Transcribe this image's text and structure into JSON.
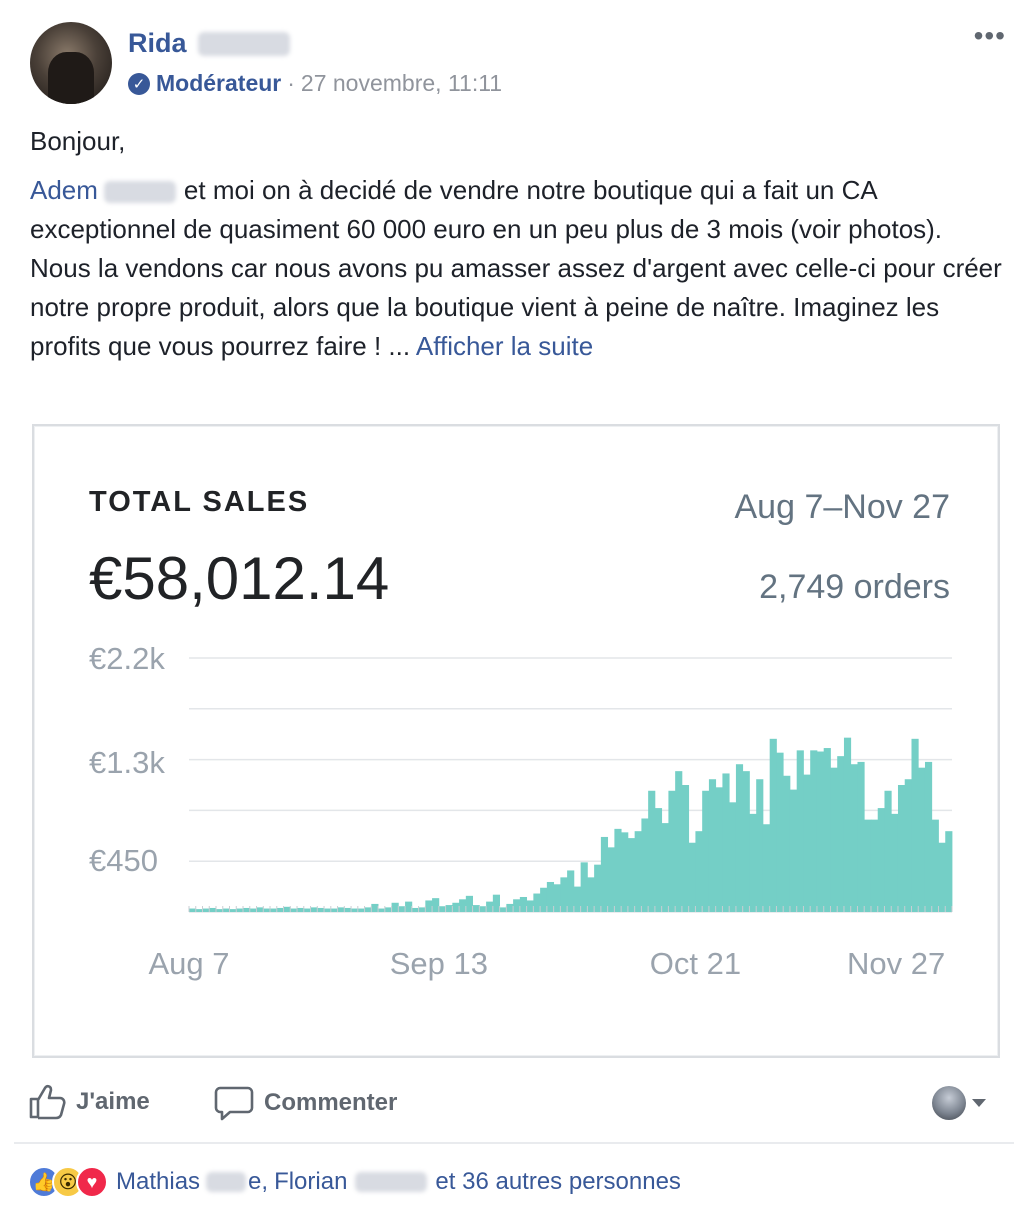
{
  "post": {
    "author_name": "Rida",
    "role": "Modérateur",
    "separator": "·",
    "timestamp": "27 novembre, 11:11",
    "more_icon": "more-horizontal-icon",
    "greeting": "Bonjour,",
    "mention": "Adem",
    "paragraph1_rest": "et moi on à decidé de vendre notre boutique qui a fait un CA exceptionnel de quasiment 60 000 euro en un peu plus de 3 mois (voir photos).",
    "paragraph2": "Nous la vendons car nous avons pu amasser assez d'argent avec celle-ci pour créer notre propre produit, alors que la boutique vient à peine de naître. Imaginez les profits que vous pourrez faire ! ...",
    "see_more": "Afficher la suite"
  },
  "chart_data": {
    "type": "bar",
    "title": "TOTAL SALES",
    "total": "€58,012.14",
    "date_range": "Aug 7–Nov 27",
    "orders": "2,749 orders",
    "y_ticks": [
      "€2.2k",
      "€1.3k",
      "€450"
    ],
    "y_tick_values": [
      2200,
      1300,
      450
    ],
    "x_ticks": [
      "Aug 7",
      "Sep 13",
      "Oct 21",
      "Nov 27"
    ],
    "x_tick_indices": [
      0,
      37,
      75,
      112
    ],
    "ylim": [
      0,
      2200
    ],
    "bar_color": "#74cfc6",
    "values": [
      30,
      25,
      30,
      35,
      25,
      30,
      25,
      30,
      35,
      30,
      40,
      30,
      30,
      35,
      45,
      30,
      35,
      30,
      40,
      35,
      30,
      30,
      40,
      35,
      30,
      30,
      40,
      70,
      30,
      40,
      80,
      50,
      90,
      35,
      40,
      100,
      120,
      50,
      60,
      80,
      110,
      140,
      60,
      50,
      90,
      150,
      40,
      70,
      110,
      130,
      100,
      160,
      210,
      260,
      240,
      300,
      360,
      220,
      430,
      300,
      410,
      650,
      560,
      720,
      690,
      640,
      700,
      810,
      1050,
      900,
      770,
      1050,
      1220,
      1100,
      600,
      700,
      1050,
      1150,
      1080,
      1200,
      950,
      1280,
      1220,
      850,
      1150,
      760,
      1500,
      1380,
      1180,
      1060,
      1400,
      1190,
      1400,
      1390,
      1420,
      1250,
      1350,
      1510,
      1280,
      1300,
      800,
      800,
      900,
      1050,
      850,
      1100,
      1150,
      1500,
      1250,
      1300,
      800,
      600,
      700
    ],
    "grid": true
  },
  "actions": {
    "like_label": "J'aime",
    "comment_label": "Commenter"
  },
  "reactions": {
    "name1": "Mathias",
    "name1_suffix": "e,",
    "name2": "Florian",
    "others": "et 36 autres personnes"
  }
}
